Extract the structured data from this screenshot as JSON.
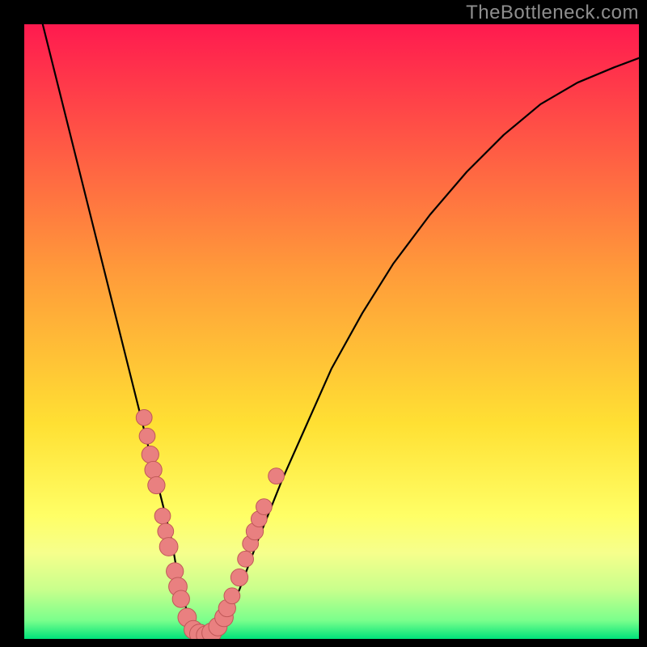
{
  "watermark": "TheBottleneck.com",
  "colors": {
    "bg": "#000000",
    "grad_top": "#ff1a4f",
    "grad_mid_upper": "#ff7a3a",
    "grad_mid": "#ffd333",
    "grad_lower": "#ffff66",
    "grad_band1": "#f6ff8c",
    "grad_band2": "#c8ff8c",
    "grad_band3": "#7aff8c",
    "grad_bottom": "#00e37a",
    "curve": "#000000",
    "dot_fill": "#e98080",
    "dot_stroke": "#c05858",
    "watermark": "#8e8e8e"
  },
  "chart_data": {
    "type": "line",
    "title": "",
    "xlabel": "",
    "ylabel": "",
    "xlim": [
      0,
      100
    ],
    "ylim": [
      0,
      100
    ],
    "grid": false,
    "series": [
      {
        "name": "curve",
        "x": [
          3,
          6,
          9,
          12,
          15,
          17,
          19,
          21,
          22.5,
          24,
          25,
          26,
          27,
          28.5,
          30,
          32,
          35,
          38,
          42,
          46,
          50,
          55,
          60,
          66,
          72,
          78,
          84,
          90,
          96,
          100
        ],
        "y": [
          100,
          88,
          76,
          64,
          52,
          44,
          36,
          28,
          22,
          16,
          10,
          6,
          3,
          1,
          0.5,
          2,
          8,
          16,
          26,
          35,
          44,
          53,
          61,
          69,
          76,
          82,
          87,
          90.5,
          93,
          94.5
        ]
      }
    ],
    "points": [
      {
        "x": 19.5,
        "y": 36,
        "r": 1.3
      },
      {
        "x": 20.0,
        "y": 33,
        "r": 1.3
      },
      {
        "x": 20.5,
        "y": 30,
        "r": 1.4
      },
      {
        "x": 21.0,
        "y": 27.5,
        "r": 1.4
      },
      {
        "x": 21.5,
        "y": 25,
        "r": 1.4
      },
      {
        "x": 22.5,
        "y": 20,
        "r": 1.3
      },
      {
        "x": 23.0,
        "y": 17.5,
        "r": 1.3
      },
      {
        "x": 23.5,
        "y": 15,
        "r": 1.5
      },
      {
        "x": 24.5,
        "y": 11,
        "r": 1.4
      },
      {
        "x": 25.0,
        "y": 8.5,
        "r": 1.5
      },
      {
        "x": 25.5,
        "y": 6.5,
        "r": 1.4
      },
      {
        "x": 26.5,
        "y": 3.5,
        "r": 1.5
      },
      {
        "x": 27.5,
        "y": 1.5,
        "r": 1.5
      },
      {
        "x": 28.5,
        "y": 0.8,
        "r": 1.6
      },
      {
        "x": 29.5,
        "y": 0.6,
        "r": 1.5
      },
      {
        "x": 30.5,
        "y": 1.0,
        "r": 1.6
      },
      {
        "x": 31.5,
        "y": 2.0,
        "r": 1.5
      },
      {
        "x": 32.5,
        "y": 3.5,
        "r": 1.5
      },
      {
        "x": 33.0,
        "y": 5.0,
        "r": 1.4
      },
      {
        "x": 33.8,
        "y": 7.0,
        "r": 1.3
      },
      {
        "x": 35.0,
        "y": 10,
        "r": 1.4
      },
      {
        "x": 36.0,
        "y": 13,
        "r": 1.3
      },
      {
        "x": 36.8,
        "y": 15.5,
        "r": 1.3
      },
      {
        "x": 37.5,
        "y": 17.5,
        "r": 1.4
      },
      {
        "x": 38.2,
        "y": 19.5,
        "r": 1.3
      },
      {
        "x": 39.0,
        "y": 21.5,
        "r": 1.3
      },
      {
        "x": 41.0,
        "y": 26.5,
        "r": 1.3
      }
    ],
    "gradient_bands": [
      {
        "y": 100,
        "color": "#ff1a4f"
      },
      {
        "y": 60,
        "color": "#ff9a3a"
      },
      {
        "y": 35,
        "color": "#ffe033"
      },
      {
        "y": 20,
        "color": "#ffff66"
      },
      {
        "y": 14,
        "color": "#f6ff8c"
      },
      {
        "y": 8,
        "color": "#c8ff8c"
      },
      {
        "y": 3,
        "color": "#7aff8c"
      },
      {
        "y": 0,
        "color": "#00e37a"
      }
    ]
  }
}
